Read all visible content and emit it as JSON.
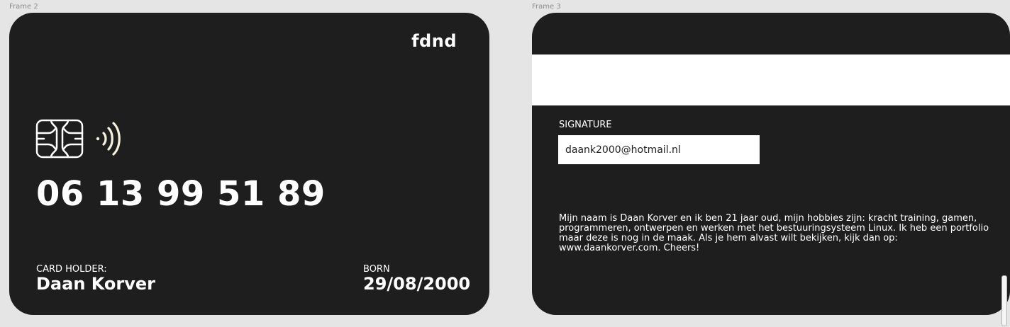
{
  "frames": {
    "front_label": "Frame 2",
    "back_label": "Frame 3"
  },
  "front": {
    "brand": "fdnd",
    "icons": {
      "chip": "card-chip-icon",
      "contactless": "contactless-icon"
    },
    "number": "06 13 99 51 89",
    "holder_label": "CARD HOLDER:",
    "holder_name": "Daan Korver",
    "born_label": "BORN",
    "born_value": "29/08/2000"
  },
  "back": {
    "signature_label": "SIGNATURE",
    "signature_value": "daank2000@hotmail.nl",
    "bio": "Mijn naam is Daan Korver en ik ben 21 jaar oud, mijn hobbies zijn: kracht training, gamen, programmeren, ontwerpen en werken met het bestuuringsysteem Linux.  Ik heb een portfolio maar deze is nog in de maak. Als je hem alvast wilt bekijken, kijk dan op: www.daankorver.com. Cheers!"
  },
  "colors": {
    "card": "#1e1e1e",
    "canvas": "#e5e5e5",
    "text": "#ffffff",
    "stripe": "#ffffff"
  }
}
